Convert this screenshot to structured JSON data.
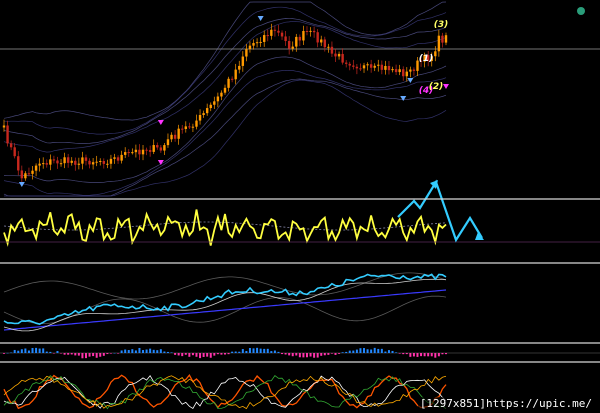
{
  "chart_data": {
    "type": "line",
    "background": "#000000",
    "grid": false,
    "wave_labels": [
      "(3)",
      "(4)",
      "(1)",
      "(2)"
    ],
    "colors": {
      "candle_up": "#ff9a00",
      "candle_down": "#c8281e",
      "price_envelope": "#4a4a8c",
      "separator": "#d8d8d8",
      "oscillator": "#ffff40",
      "forecast_arrow": "#33ccff",
      "indicator_main": "#33ccff",
      "indicator_signal": "#d0d0d0",
      "indicator_trend": "#3a3aff",
      "histogram_up": "#2288ff",
      "histogram_down": "#ff33aa",
      "marker_magenta": "#ff33ff",
      "marker_blue": "#66aaff",
      "wave_label_yellow": "#ffff66",
      "status_dot": "#2a9d7a"
    },
    "wave_annotations": [
      {
        "label": "(3)",
        "index": 124,
        "color": "#ffff66"
      },
      {
        "label": "(4)",
        "index": 118,
        "color": "#ff33ff"
      },
      {
        "label": "(1)",
        "index": 115,
        "color": "#ffffff"
      },
      {
        "label": "(2)",
        "index": 119,
        "color": "#ffff66"
      }
    ]
  },
  "watermark": "[1297x851]https://upic.me/"
}
